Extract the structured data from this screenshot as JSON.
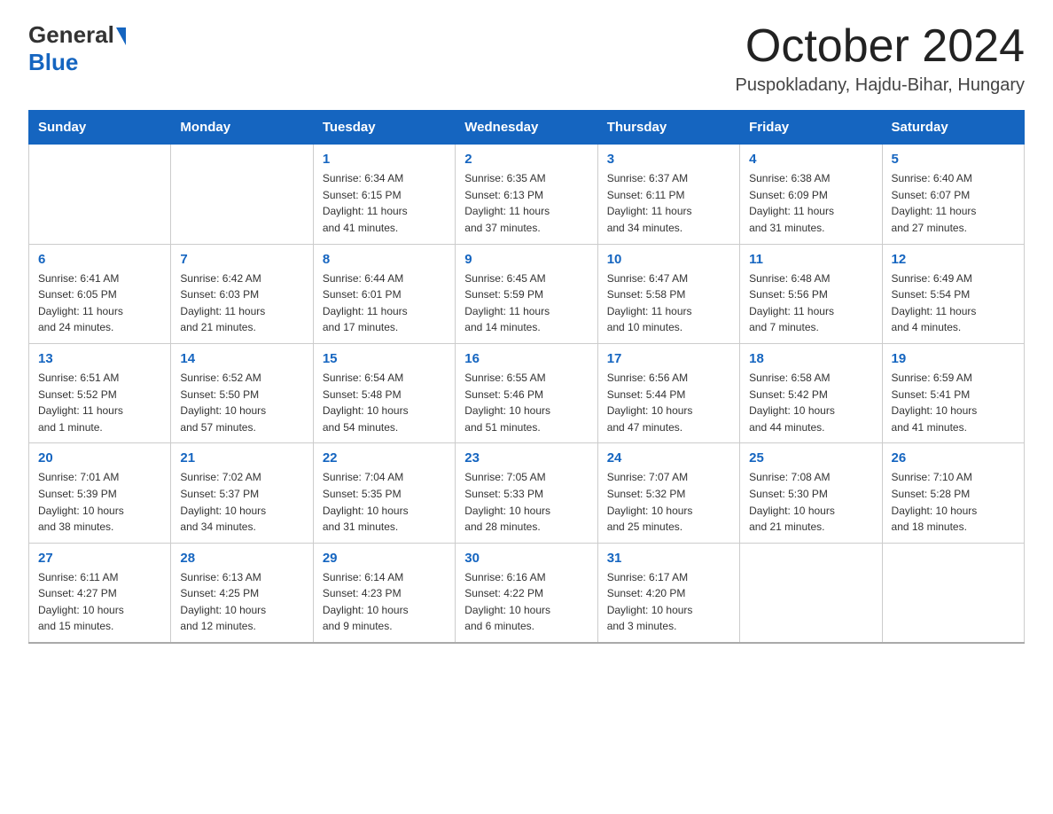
{
  "header": {
    "logo_general": "General",
    "logo_blue": "Blue",
    "month_title": "October 2024",
    "location": "Puspokladany, Hajdu-Bihar, Hungary"
  },
  "weekdays": [
    "Sunday",
    "Monday",
    "Tuesday",
    "Wednesday",
    "Thursday",
    "Friday",
    "Saturday"
  ],
  "weeks": [
    [
      {
        "day": "",
        "info": ""
      },
      {
        "day": "",
        "info": ""
      },
      {
        "day": "1",
        "info": "Sunrise: 6:34 AM\nSunset: 6:15 PM\nDaylight: 11 hours\nand 41 minutes."
      },
      {
        "day": "2",
        "info": "Sunrise: 6:35 AM\nSunset: 6:13 PM\nDaylight: 11 hours\nand 37 minutes."
      },
      {
        "day": "3",
        "info": "Sunrise: 6:37 AM\nSunset: 6:11 PM\nDaylight: 11 hours\nand 34 minutes."
      },
      {
        "day": "4",
        "info": "Sunrise: 6:38 AM\nSunset: 6:09 PM\nDaylight: 11 hours\nand 31 minutes."
      },
      {
        "day": "5",
        "info": "Sunrise: 6:40 AM\nSunset: 6:07 PM\nDaylight: 11 hours\nand 27 minutes."
      }
    ],
    [
      {
        "day": "6",
        "info": "Sunrise: 6:41 AM\nSunset: 6:05 PM\nDaylight: 11 hours\nand 24 minutes."
      },
      {
        "day": "7",
        "info": "Sunrise: 6:42 AM\nSunset: 6:03 PM\nDaylight: 11 hours\nand 21 minutes."
      },
      {
        "day": "8",
        "info": "Sunrise: 6:44 AM\nSunset: 6:01 PM\nDaylight: 11 hours\nand 17 minutes."
      },
      {
        "day": "9",
        "info": "Sunrise: 6:45 AM\nSunset: 5:59 PM\nDaylight: 11 hours\nand 14 minutes."
      },
      {
        "day": "10",
        "info": "Sunrise: 6:47 AM\nSunset: 5:58 PM\nDaylight: 11 hours\nand 10 minutes."
      },
      {
        "day": "11",
        "info": "Sunrise: 6:48 AM\nSunset: 5:56 PM\nDaylight: 11 hours\nand 7 minutes."
      },
      {
        "day": "12",
        "info": "Sunrise: 6:49 AM\nSunset: 5:54 PM\nDaylight: 11 hours\nand 4 minutes."
      }
    ],
    [
      {
        "day": "13",
        "info": "Sunrise: 6:51 AM\nSunset: 5:52 PM\nDaylight: 11 hours\nand 1 minute."
      },
      {
        "day": "14",
        "info": "Sunrise: 6:52 AM\nSunset: 5:50 PM\nDaylight: 10 hours\nand 57 minutes."
      },
      {
        "day": "15",
        "info": "Sunrise: 6:54 AM\nSunset: 5:48 PM\nDaylight: 10 hours\nand 54 minutes."
      },
      {
        "day": "16",
        "info": "Sunrise: 6:55 AM\nSunset: 5:46 PM\nDaylight: 10 hours\nand 51 minutes."
      },
      {
        "day": "17",
        "info": "Sunrise: 6:56 AM\nSunset: 5:44 PM\nDaylight: 10 hours\nand 47 minutes."
      },
      {
        "day": "18",
        "info": "Sunrise: 6:58 AM\nSunset: 5:42 PM\nDaylight: 10 hours\nand 44 minutes."
      },
      {
        "day": "19",
        "info": "Sunrise: 6:59 AM\nSunset: 5:41 PM\nDaylight: 10 hours\nand 41 minutes."
      }
    ],
    [
      {
        "day": "20",
        "info": "Sunrise: 7:01 AM\nSunset: 5:39 PM\nDaylight: 10 hours\nand 38 minutes."
      },
      {
        "day": "21",
        "info": "Sunrise: 7:02 AM\nSunset: 5:37 PM\nDaylight: 10 hours\nand 34 minutes."
      },
      {
        "day": "22",
        "info": "Sunrise: 7:04 AM\nSunset: 5:35 PM\nDaylight: 10 hours\nand 31 minutes."
      },
      {
        "day": "23",
        "info": "Sunrise: 7:05 AM\nSunset: 5:33 PM\nDaylight: 10 hours\nand 28 minutes."
      },
      {
        "day": "24",
        "info": "Sunrise: 7:07 AM\nSunset: 5:32 PM\nDaylight: 10 hours\nand 25 minutes."
      },
      {
        "day": "25",
        "info": "Sunrise: 7:08 AM\nSunset: 5:30 PM\nDaylight: 10 hours\nand 21 minutes."
      },
      {
        "day": "26",
        "info": "Sunrise: 7:10 AM\nSunset: 5:28 PM\nDaylight: 10 hours\nand 18 minutes."
      }
    ],
    [
      {
        "day": "27",
        "info": "Sunrise: 6:11 AM\nSunset: 4:27 PM\nDaylight: 10 hours\nand 15 minutes."
      },
      {
        "day": "28",
        "info": "Sunrise: 6:13 AM\nSunset: 4:25 PM\nDaylight: 10 hours\nand 12 minutes."
      },
      {
        "day": "29",
        "info": "Sunrise: 6:14 AM\nSunset: 4:23 PM\nDaylight: 10 hours\nand 9 minutes."
      },
      {
        "day": "30",
        "info": "Sunrise: 6:16 AM\nSunset: 4:22 PM\nDaylight: 10 hours\nand 6 minutes."
      },
      {
        "day": "31",
        "info": "Sunrise: 6:17 AM\nSunset: 4:20 PM\nDaylight: 10 hours\nand 3 minutes."
      },
      {
        "day": "",
        "info": ""
      },
      {
        "day": "",
        "info": ""
      }
    ]
  ]
}
